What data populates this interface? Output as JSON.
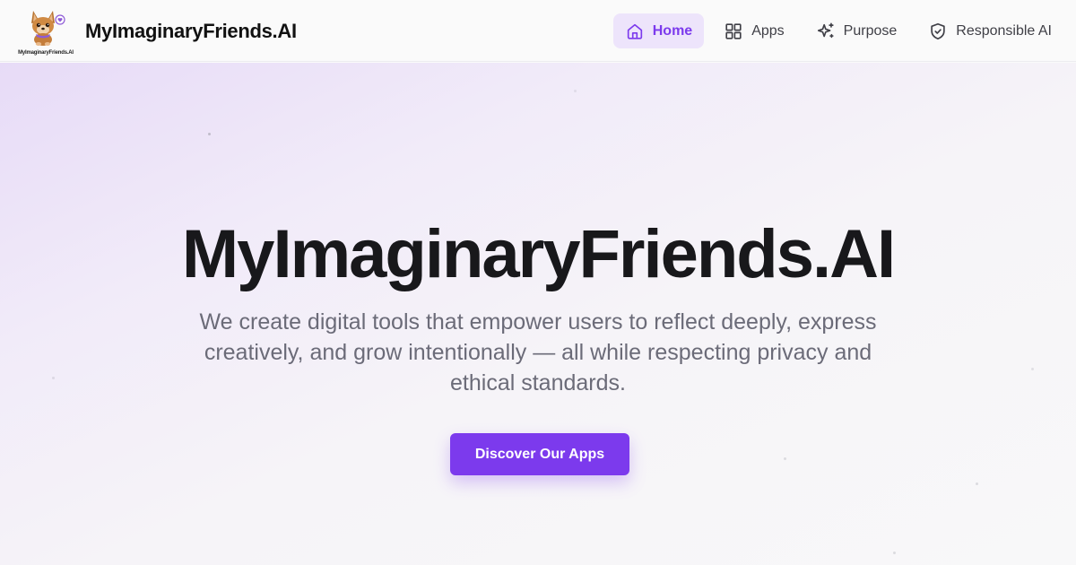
{
  "brand": {
    "logo_caption": "MyImaginaryFriends.AI",
    "name": "MyImaginaryFriends.AI",
    "logo_icon": "puppy-mascot-icon"
  },
  "nav": {
    "items": [
      {
        "label": "Home",
        "icon": "home-icon",
        "active": true
      },
      {
        "label": "Apps",
        "icon": "grid-icon",
        "active": false
      },
      {
        "label": "Purpose",
        "icon": "sparkles-icon",
        "active": false
      },
      {
        "label": "Responsible AI",
        "icon": "shield-check-icon",
        "active": false
      }
    ]
  },
  "hero": {
    "title": "MyImaginaryFriends.AI",
    "subtitle": "We create digital tools that empower users to reflect deeply, express creatively, and grow intentionally — all while respecting privacy and ethical standards.",
    "cta_label": "Discover Our Apps"
  },
  "colors": {
    "accent": "#7c3aed",
    "active_nav_bg": "#ede4fb",
    "title": "#18181b",
    "subtitle": "#6b6b78"
  }
}
